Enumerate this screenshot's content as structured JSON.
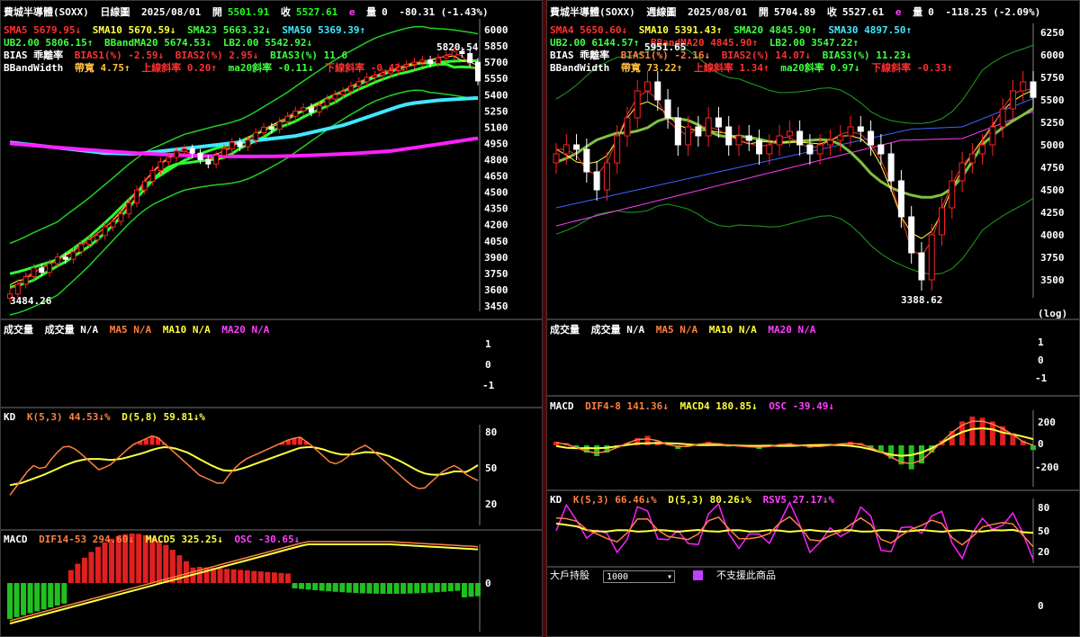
{
  "left": {
    "title": "費城半導體(SOXX)",
    "period": "日線圖",
    "date": "2025/08/01",
    "open_label": "開",
    "open": "5501.91",
    "close_label": "收",
    "close": "5527.61",
    "flag": "e",
    "vol_label": "量",
    "vol": "0",
    "change": "-80.31 (-1.43%)",
    "ma_line1": [
      "SMA5 5679.95↓",
      "SMA10 5670.59↓",
      "SMA23 5663.32↓",
      "SMA50 5369.39↑"
    ],
    "ma_line2": [
      "UB2.00 5806.15↑",
      "BBandMA20 5674.53↓",
      "LB2.00 5542.92↓"
    ],
    "ma_line3": [
      "BIAS 乖離率",
      "BIAS1(%) -2.59↓",
      "BIAS2(%) 2.95↓",
      "BIAS3(%) 11.6"
    ],
    "ma_line4": [
      "BBandWidth",
      "帶寬 4.75↑",
      "上線斜率 0.20↑",
      "ma20斜率 -0.11↓",
      "下線斜率 -0.42↓"
    ],
    "high_label": "5820.54",
    "low_label": "3484.26",
    "yticks": [
      "6000",
      "5850",
      "5700",
      "5550",
      "5400",
      "5250",
      "5100",
      "4950",
      "4800",
      "4650",
      "4500",
      "4350",
      "4200",
      "4050",
      "3900",
      "3750",
      "3600",
      "3450"
    ],
    "volume_header": [
      "成交量",
      "成交量 N/A",
      "MA5 N/A",
      "MA10 N/A",
      "MA20 N/A"
    ],
    "volume_ticks": [
      "1",
      "0",
      "-1"
    ],
    "kd_header": [
      "KD",
      "K(5,3) 44.53↓%",
      "D(5,8) 59.81↓%"
    ],
    "kd_ticks": [
      "80",
      "50",
      "20"
    ],
    "macd_header": [
      "MACD",
      "DIF14-53 294.60↓",
      "MACD5 325.25↓",
      "OSC -30.65↓"
    ],
    "macd_ticks": [
      "0"
    ]
  },
  "right": {
    "title": "費城半導體(SOXX)",
    "period": "週線圖",
    "date": "2025/08/01",
    "open_label": "開",
    "open": "5704.89",
    "close_label": "收",
    "close": "5527.61",
    "flag": "e",
    "vol_label": "量",
    "vol": "0",
    "change": "-118.25 (-2.09%)",
    "ma_line1": [
      "SMA4 5650.60↓",
      "SMA10 5391.43↑",
      "SMA20 4845.90↑",
      "SMA30 4897.50↑"
    ],
    "ma_line2": [
      "UB2.00 6144.57↑",
      "BBandMA20 4845.90↑",
      "LB2.00 3547.22↑"
    ],
    "ma_line3": [
      "BIAS 乖離率",
      "BIAS1(%) -2.16↓",
      "BIAS2(%) 14.07↓",
      "BIAS3(%) 11.23↓"
    ],
    "ma_line4": [
      "BBandWidth",
      "帶寬 73.22↑",
      "上線斜率 1.34↑",
      "ma20斜率 0.97↓",
      "下線斜率 -0.33↑"
    ],
    "high_label": "5951.65",
    "low_label": "3388.62",
    "yticks": [
      "6250",
      "6000",
      "5750",
      "5500",
      "5250",
      "5000",
      "4750",
      "4500",
      "4250",
      "4000",
      "3750",
      "3500"
    ],
    "log_label": "(log)",
    "volume_header": [
      "成交量",
      "成交量 N/A",
      "MA5 N/A",
      "MA10 N/A",
      "MA20 N/A"
    ],
    "volume_ticks": [
      "1",
      "0",
      "-1"
    ],
    "macd_header": [
      "MACD",
      "DIF4-8 141.36↓",
      "MACD4 180.85↓",
      "OSC -39.49↓"
    ],
    "macd_ticks": [
      "200",
      "0",
      "-200"
    ],
    "kd_header": [
      "KD",
      "K(5,3) 66.46↓%",
      "D(5,3) 80.26↓%",
      "RSV5 27.17↓%"
    ],
    "kd_ticks": [
      "80",
      "50",
      "20"
    ],
    "holder_label": "大戶持股",
    "holder_select": "1000",
    "holder_note": "不支援此商品",
    "holder_ticks": [
      "0"
    ]
  },
  "colors": {
    "up": "#ff2020",
    "down": "#ffffff",
    "green": "#20ff20",
    "yellow": "#ffff40",
    "cyan": "#40e8ff",
    "magenta": "#ff20ff",
    "orange": "#ff8040",
    "red": "#ff3030"
  },
  "chart_data": [
    {
      "type": "candlestick",
      "title": "費城半導體(SOXX) 日線圖",
      "ylim": [
        3400,
        6100
      ],
      "series_close": [
        3560,
        3650,
        3720,
        3800,
        3760,
        3840,
        3900,
        3880,
        3950,
        4020,
        4060,
        4100,
        4180,
        4230,
        4300,
        4400,
        4520,
        4600,
        4700,
        4780,
        4820,
        4880,
        4900,
        4860,
        4800,
        4760,
        4840,
        4900,
        4960,
        4920,
        4980,
        5050,
        5100,
        5080,
        5150,
        5200,
        5250,
        5280,
        5240,
        5300,
        5360,
        5400,
        5430,
        5480,
        5520,
        5560,
        5580,
        5600,
        5620,
        5660,
        5680,
        5700,
        5720,
        5690,
        5740,
        5760,
        5800,
        5780,
        5700,
        5527.61
      ],
      "ma_sma50": [
        4960,
        4950,
        4940,
        4930,
        4920,
        4910,
        4900,
        4890,
        4880,
        4870,
        4860,
        4860,
        4855,
        4855,
        4860,
        4870,
        4880,
        4890,
        4900,
        4910,
        4920,
        4930,
        4940,
        4950,
        4960,
        4970,
        4980,
        4990,
        5000,
        5010,
        5020,
        5040,
        5060,
        5080,
        5100,
        5120,
        5150,
        5180,
        5210,
        5240,
        5270,
        5300,
        5320,
        5330,
        5340,
        5350,
        5355,
        5360,
        5365,
        5369.39
      ],
      "kd_k": [
        30,
        45,
        60,
        55,
        70,
        80,
        75,
        65,
        55,
        60,
        70,
        80,
        85,
        90,
        80,
        70,
        60,
        50,
        45,
        40,
        55,
        65,
        70,
        75,
        80,
        85,
        88,
        80,
        70,
        60,
        65,
        75,
        80,
        70,
        60,
        50,
        40,
        35,
        45,
        55,
        60,
        50,
        44.53
      ],
      "kd_d": [
        40,
        42,
        46,
        50,
        55,
        60,
        64,
        66,
        66,
        65,
        66,
        69,
        72,
        76,
        78,
        76,
        72,
        66,
        60,
        55,
        54,
        57,
        61,
        65,
        69,
        73,
        77,
        78,
        76,
        72,
        70,
        71,
        73,
        72,
        69,
        64,
        58,
        52,
        50,
        51,
        54,
        53,
        59.81
      ]
    },
    {
      "type": "candlestick",
      "title": "費城半導體(SOXX) 週線圖",
      "ylim": [
        3300,
        6350
      ],
      "series_close": [
        4900,
        5000,
        4950,
        4700,
        4500,
        4800,
        5100,
        5300,
        5600,
        5700,
        5500,
        5300,
        5000,
        5200,
        5100,
        5300,
        5200,
        5000,
        5100,
        5050,
        4900,
        5000,
        5100,
        5150,
        5000,
        4900,
        5000,
        5050,
        5100,
        5200,
        5150,
        5000,
        4900,
        4600,
        4200,
        3800,
        3500,
        4000,
        4300,
        4600,
        4800,
        4900,
        5000,
        5200,
        5400,
        5600,
        5700,
        5527.61
      ],
      "macd_osc": [
        30,
        20,
        -20,
        -60,
        -90,
        -60,
        -20,
        20,
        60,
        80,
        40,
        10,
        -30,
        -10,
        10,
        30,
        20,
        -10,
        0,
        -10,
        -30,
        -10,
        10,
        20,
        0,
        -20,
        -10,
        0,
        10,
        30,
        20,
        -20,
        -60,
        -110,
        -160,
        -200,
        -150,
        -60,
        40,
        120,
        200,
        240,
        230,
        200,
        160,
        100,
        40,
        -39.49
      ]
    }
  ]
}
